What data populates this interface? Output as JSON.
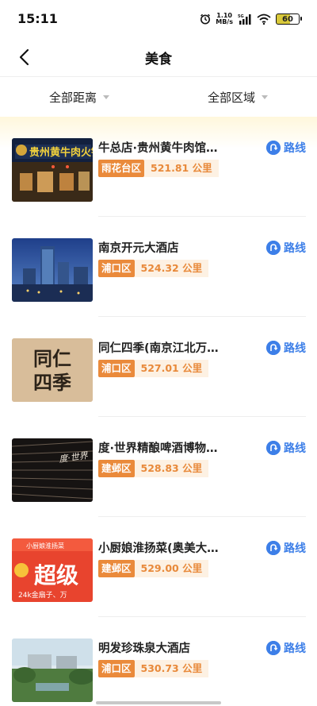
{
  "status_bar": {
    "time": "15:11",
    "net_speed": "1.10",
    "net_unit": "MB/s",
    "battery": "60"
  },
  "nav": {
    "title": "美食"
  },
  "filters": [
    {
      "label": "全部距离"
    },
    {
      "label": "全部区域"
    }
  ],
  "restaurants": [
    {
      "name": "牛总店·贵州黄牛肉馆…",
      "district": "雨花台区",
      "distance": "521.81 公里",
      "route_label": "路线",
      "thumb_text": "贵州黄牛肉火锅"
    },
    {
      "name": "南京开元大酒店",
      "district": "浦口区",
      "distance": "524.32 公里",
      "route_label": "路线"
    },
    {
      "name": "同仁四季(南京江北万…",
      "district": "浦口区",
      "distance": "527.01 公里",
      "route_label": "路线",
      "thumb_text_1": "同仁",
      "thumb_text_2": "四季"
    },
    {
      "name": "度·世界精酿啤酒博物…",
      "district": "建邺区",
      "distance": "528.83 公里",
      "route_label": "路线",
      "thumb_text": "度·世界"
    },
    {
      "name": "小厨娘淮扬菜(奥美大…",
      "district": "建邺区",
      "distance": "529.00 公里",
      "route_label": "路线",
      "thumb_text_1": "小厨娘淮扬菜",
      "thumb_text_2": "超级",
      "thumb_text_3": "24k金扇子、万"
    },
    {
      "name": "明发珍珠泉大酒店",
      "district": "浦口区",
      "distance": "530.73 公里",
      "route_label": "路线"
    }
  ],
  "colors": {
    "accent_blue": "#3d7fe8",
    "district_orange": "#ea8a3b",
    "distance_bg": "#fdf1e3",
    "header_gradient": "#fff7dc"
  }
}
